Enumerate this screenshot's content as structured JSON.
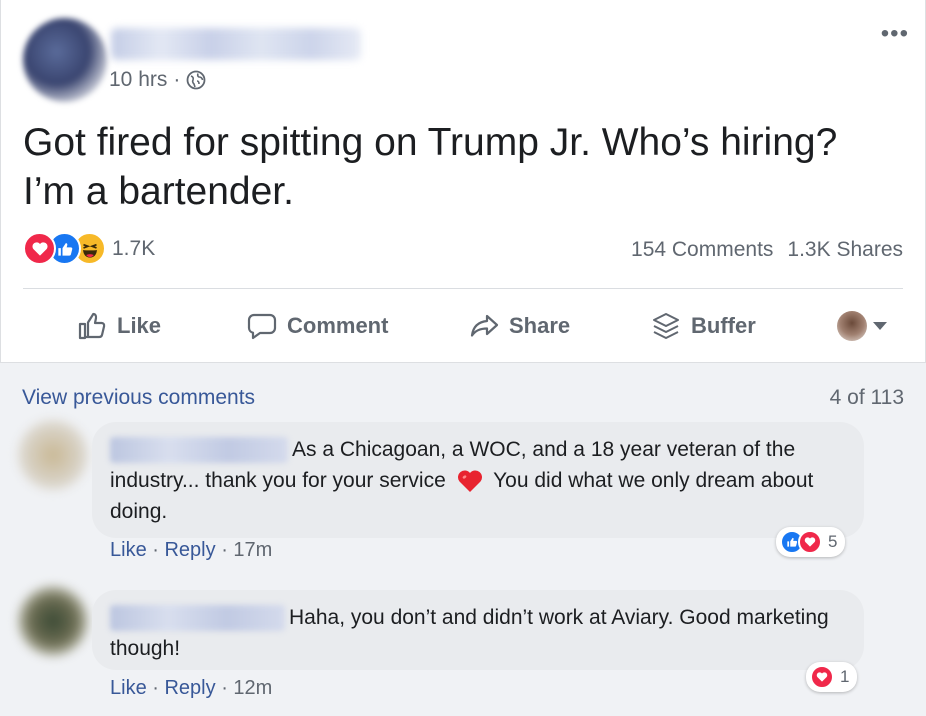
{
  "post": {
    "time": "10 hrs",
    "separator": "·",
    "text_line1": "Got fired for spitting on Trump Jr. Who’s hiring?",
    "text_line2": "I’m a bartender.",
    "reaction_count": "1.7K",
    "comments_count": "154 Comments",
    "shares_count": "1.3K Shares",
    "more_label": "•••"
  },
  "actions": {
    "like": "Like",
    "comment": "Comment",
    "share": "Share",
    "buffer": "Buffer"
  },
  "comments_section": {
    "view_previous": "View previous comments",
    "position": "4 of 113",
    "comments": [
      {
        "text_a": "As a Chicagoan, a WOC, and a 18 year veteran of the industry... thank you for your service",
        "text_b": "You did what we only dream about doing.",
        "reaction_count": "5",
        "like": "Like",
        "reply": "Reply",
        "time": "17m"
      },
      {
        "text_a": "Haha, you don’t and didn’t work at Aviary. Good marketing though!",
        "reaction_count": "1",
        "like": "Like",
        "reply": "Reply",
        "time": "12m"
      }
    ]
  },
  "colors": {
    "link": "#385898",
    "like_blue": "#1877f2",
    "love_red": "#f0284a",
    "haha_yellow": "#f7b928",
    "bubble_bg": "#e9ebee"
  }
}
